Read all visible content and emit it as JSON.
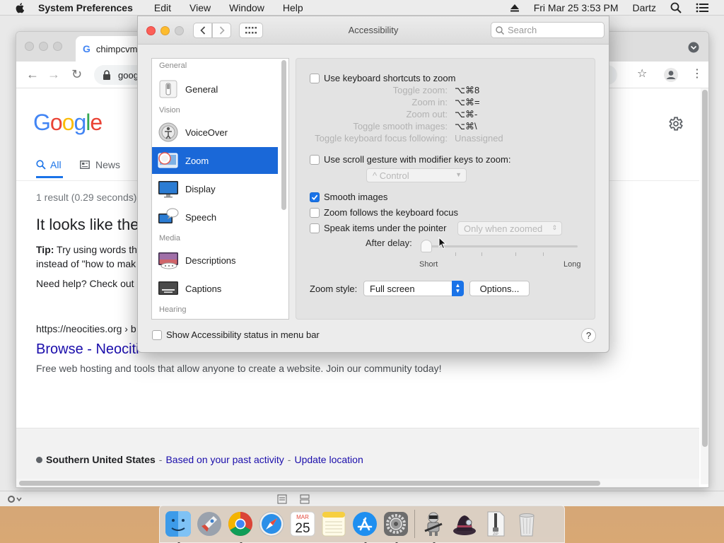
{
  "menubar": {
    "app_name": "System Preferences",
    "menus": [
      "Edit",
      "View",
      "Window",
      "Help"
    ],
    "datetime": "Fri Mar 25  3:53 PM",
    "user": "Dartz"
  },
  "chrome": {
    "tab_title": "chimpcvm",
    "url_partial": "goog",
    "google_tabs": [
      {
        "label": "All",
        "icon": "search-icon",
        "active": true
      },
      {
        "label": "News",
        "icon": "newspaper-icon",
        "active": false
      }
    ],
    "result_stats": "1 result (0.29 seconds)",
    "heading": "It looks like the",
    "tip_label": "Tip:",
    "tip_line1": "Try using words th",
    "tip_line2": "instead of \"how to mak",
    "help_text": "Need help? Check out c",
    "result_cite": "https://neocities.org › b",
    "result_title": "Browse - Neociti",
    "result_snippet": "Free web hosting and tools that allow anyone to create a website. Join our community today!",
    "footer_location": "Southern United States",
    "footer_link1": "Based on your past activity",
    "footer_link2": "Update location"
  },
  "prefs": {
    "title": "Accessibility",
    "search_placeholder": "Search",
    "sidebar": {
      "sections": {
        "general": "General",
        "vision": "Vision",
        "media": "Media",
        "hearing": "Hearing"
      },
      "items": [
        {
          "label": "General",
          "icon": "general-switch-icon",
          "selected": false
        },
        {
          "label": "VoiceOver",
          "icon": "voiceover-icon",
          "selected": false
        },
        {
          "label": "Zoom",
          "icon": "zoom-magnifier-icon",
          "selected": true
        },
        {
          "label": "Display",
          "icon": "display-monitor-icon",
          "selected": false
        },
        {
          "label": "Speech",
          "icon": "speech-bubble-icon",
          "selected": false
        },
        {
          "label": "Descriptions",
          "icon": "descriptions-icon",
          "selected": false
        },
        {
          "label": "Captions",
          "icon": "captions-icon",
          "selected": false
        }
      ]
    },
    "zoom": {
      "kbd_shortcuts_label": "Use keyboard shortcuts to zoom",
      "kbd_shortcuts_checked": false,
      "shortcuts": [
        {
          "label": "Toggle zoom:",
          "value": "⌥⌘8"
        },
        {
          "label": "Zoom in:",
          "value": "⌥⌘="
        },
        {
          "label": "Zoom out:",
          "value": "⌥⌘-"
        },
        {
          "label": "Toggle smooth images:",
          "value": "⌥⌘\\"
        },
        {
          "label": "Toggle keyboard focus following:",
          "value": "Unassigned"
        }
      ],
      "scroll_gesture_label": "Use scroll gesture with modifier keys to zoom:",
      "scroll_gesture_checked": false,
      "modifier_value": "^ Control",
      "smooth_images_label": "Smooth images",
      "smooth_images_checked": true,
      "follow_focus_label": "Zoom follows the keyboard focus",
      "follow_focus_checked": false,
      "speak_items_label": "Speak items under the pointer",
      "speak_items_checked": false,
      "speak_items_mode": "Only when zoomed",
      "after_delay_label": "After delay:",
      "delay_short": "Short",
      "delay_long": "Long",
      "delay_level": 0,
      "zoom_style_label": "Zoom style:",
      "zoom_style_value": "Full screen",
      "options_label": "Options..."
    },
    "status_menu_label": "Show Accessibility status in menu bar",
    "status_menu_checked": false,
    "help_label": "?"
  },
  "dock": {
    "items": [
      "finder-icon",
      "launchpad-icon",
      "chrome-icon",
      "safari-icon",
      "calendar-icon",
      "notes-icon",
      "app-store-icon",
      "system-preferences-icon",
      "automator-icon",
      "alfred-icon",
      "archive-utility-icon",
      "trash-icon"
    ],
    "calendar_month": "MAR",
    "calendar_day": "25"
  }
}
